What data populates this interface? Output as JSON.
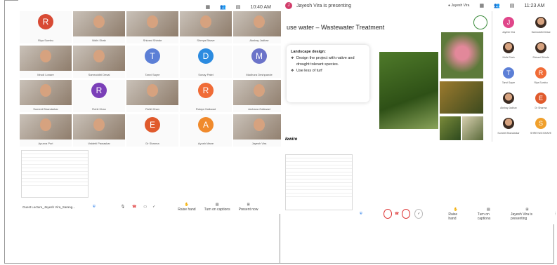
{
  "left": {
    "time": "10:40 AM",
    "tiles": [
      {
        "name": "Riya Sumbu",
        "type": "avatar",
        "letter": "R",
        "color": "#d84a34"
      },
      {
        "name": "Nidhi Shah",
        "type": "photo"
      },
      {
        "name": "Shivani Shinde",
        "type": "photo"
      },
      {
        "name": "Shreya Bhave",
        "type": "photo"
      },
      {
        "name": "Akshay Jadhav",
        "type": "photo"
      },
      {
        "name": "Mrudi Lonare",
        "type": "photo"
      },
      {
        "name": "Samruddhi Desai",
        "type": "photo"
      },
      {
        "name": "Tanvi Sayre",
        "type": "avatar",
        "letter": "T",
        "color": "#5c7fd6"
      },
      {
        "name": "Sonay Patel",
        "type": "avatar",
        "letter": "D",
        "color": "#2b8be0"
      },
      {
        "name": "Madhura Deshpande",
        "type": "avatar",
        "letter": "M",
        "color": "#6b73c9"
      },
      {
        "name": "Sumeet Bhandarkar",
        "type": "photo"
      },
      {
        "name": "Rohit Khan",
        "type": "avatar",
        "letter": "R",
        "color": "#7b3fb8"
      },
      {
        "name": "Rohit Khan",
        "type": "photo"
      },
      {
        "name": "Rutuja Gaikwad",
        "type": "avatar",
        "letter": "R",
        "color": "#f06b36"
      },
      {
        "name": "Archana Gaikwad",
        "type": "photo"
      },
      {
        "name": "Apurva Puri",
        "type": "photo"
      },
      {
        "name": "Vaidehi Pawaskar",
        "type": "photo"
      },
      {
        "name": "Dr Sharma",
        "type": "avatar",
        "letter": "E",
        "color": "#e05a2c"
      },
      {
        "name": "Ayush Mane",
        "type": "avatar",
        "letter": "A",
        "color": "#f08a2c"
      },
      {
        "name": "Jayesh Vira",
        "type": "photo"
      }
    ],
    "meeting": "Guest Lecture_Jayesh Vira_Sarang...",
    "controls": {
      "raise": "Raise hand",
      "captions": "Turn on captions",
      "present": "Present now"
    }
  },
  "right": {
    "presenting": "Jayesh Vira is presenting",
    "time": "11:23 AM",
    "slide_title": "use water – Wastewater Treatment",
    "card_title": "Landscape design:",
    "bullets": [
      "Design the project with native and drought tolerant species.",
      "Use less of turf"
    ],
    "word": "lewiro",
    "participants": [
      {
        "name": "Jayesh Vira",
        "type": "avatar",
        "letter": "J",
        "color": "#e0468a"
      },
      {
        "name": "Samruddhi Desai",
        "type": "photo"
      },
      {
        "name": "Nidhi Shah",
        "type": "photo"
      },
      {
        "name": "Shivani Shinde",
        "type": "photo"
      },
      {
        "name": "Tanvi Sayre",
        "type": "avatar",
        "letter": "T",
        "color": "#5c7fd6"
      },
      {
        "name": "Riya Sumbu",
        "type": "avatar",
        "letter": "R",
        "color": "#f06b36"
      },
      {
        "name": "Akshay Jadhav",
        "type": "photo"
      },
      {
        "name": "Dr Sharma",
        "type": "avatar",
        "letter": "E",
        "color": "#e05a2c"
      },
      {
        "name": "Sumeet Bhandarkar",
        "type": "photo"
      },
      {
        "name": "SHREYASI BHAVE",
        "type": "avatar",
        "letter": "S",
        "color": "#f0a02c"
      }
    ],
    "controls": {
      "raise": "Raise hand",
      "captions": "Turn on captions",
      "presenting": "Jayesh Vira is presenting"
    }
  }
}
